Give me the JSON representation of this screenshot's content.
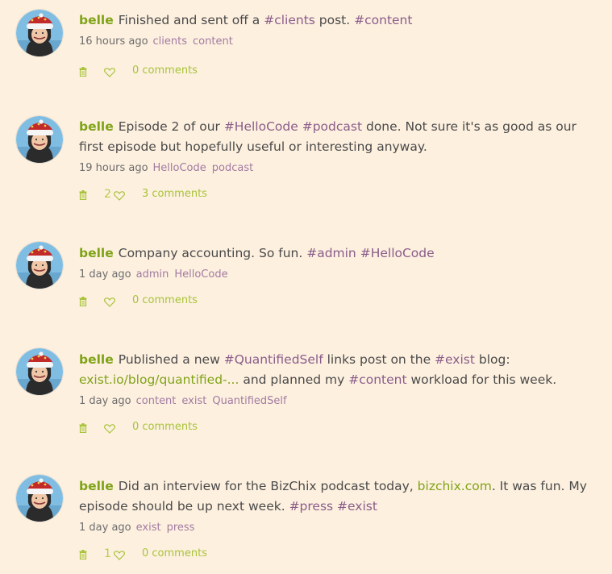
{
  "posts": [
    {
      "user": "belle",
      "segments": [
        {
          "t": "text",
          "v": "Finished and sent off a "
        },
        {
          "t": "tag",
          "v": "#clients"
        },
        {
          "t": "text",
          "v": " post. "
        },
        {
          "t": "tag",
          "v": "#content"
        }
      ],
      "time": "16 hours ago",
      "tags": [
        "clients",
        "content"
      ],
      "likes": "",
      "comments": "0 comments"
    },
    {
      "user": "belle",
      "segments": [
        {
          "t": "text",
          "v": "Episode 2 of our "
        },
        {
          "t": "tag",
          "v": "#HelloCode"
        },
        {
          "t": "text",
          "v": " "
        },
        {
          "t": "tag",
          "v": "#podcast"
        },
        {
          "t": "text",
          "v": " done. Not sure it's as good as our first episode but hopefully useful or interesting anyway."
        }
      ],
      "time": "19 hours ago",
      "tags": [
        "HelloCode",
        "podcast"
      ],
      "likes": "2",
      "comments": "3 comments"
    },
    {
      "user": "belle",
      "segments": [
        {
          "t": "text",
          "v": "Company accounting. So fun. "
        },
        {
          "t": "tag",
          "v": "#admin"
        },
        {
          "t": "text",
          "v": " "
        },
        {
          "t": "tag",
          "v": "#HelloCode"
        }
      ],
      "time": "1 day ago",
      "tags": [
        "admin",
        "HelloCode"
      ],
      "likes": "",
      "comments": "0 comments"
    },
    {
      "user": "belle",
      "segments": [
        {
          "t": "text",
          "v": "Published a new "
        },
        {
          "t": "tag",
          "v": "#QuantifiedSelf"
        },
        {
          "t": "text",
          "v": " links post on the "
        },
        {
          "t": "tag",
          "v": "#exist"
        },
        {
          "t": "text",
          "v": " blog: "
        },
        {
          "t": "link",
          "v": "exist.io/blog/quantified-..."
        },
        {
          "t": "text",
          "v": " and planned my "
        },
        {
          "t": "tag",
          "v": "#content"
        },
        {
          "t": "text",
          "v": " workload for this week."
        }
      ],
      "time": "1 day ago",
      "tags": [
        "content",
        "exist",
        "QuantifiedSelf"
      ],
      "likes": "",
      "comments": "0 comments"
    },
    {
      "user": "belle",
      "segments": [
        {
          "t": "text",
          "v": "Did an interview for the BizChix podcast today, "
        },
        {
          "t": "link",
          "v": "bizchix.com"
        },
        {
          "t": "text",
          "v": ". It was fun. My episode should be up next week. "
        },
        {
          "t": "tag",
          "v": "#press"
        },
        {
          "t": "text",
          "v": " "
        },
        {
          "t": "tag",
          "v": "#exist"
        }
      ],
      "time": "1 day ago",
      "tags": [
        "exist",
        "press"
      ],
      "likes": "1",
      "comments": "0 comments"
    }
  ],
  "icons": {
    "avatar": "avatar-santa-hat",
    "delete": "trash-icon",
    "like": "heart-icon"
  },
  "colors": {
    "background": "#fdf0df",
    "username": "#7fa317",
    "hashtag": "#8a5c8a",
    "link": "#7fa317",
    "meta_tag": "#a27ba2",
    "action": "#a8c33a"
  }
}
